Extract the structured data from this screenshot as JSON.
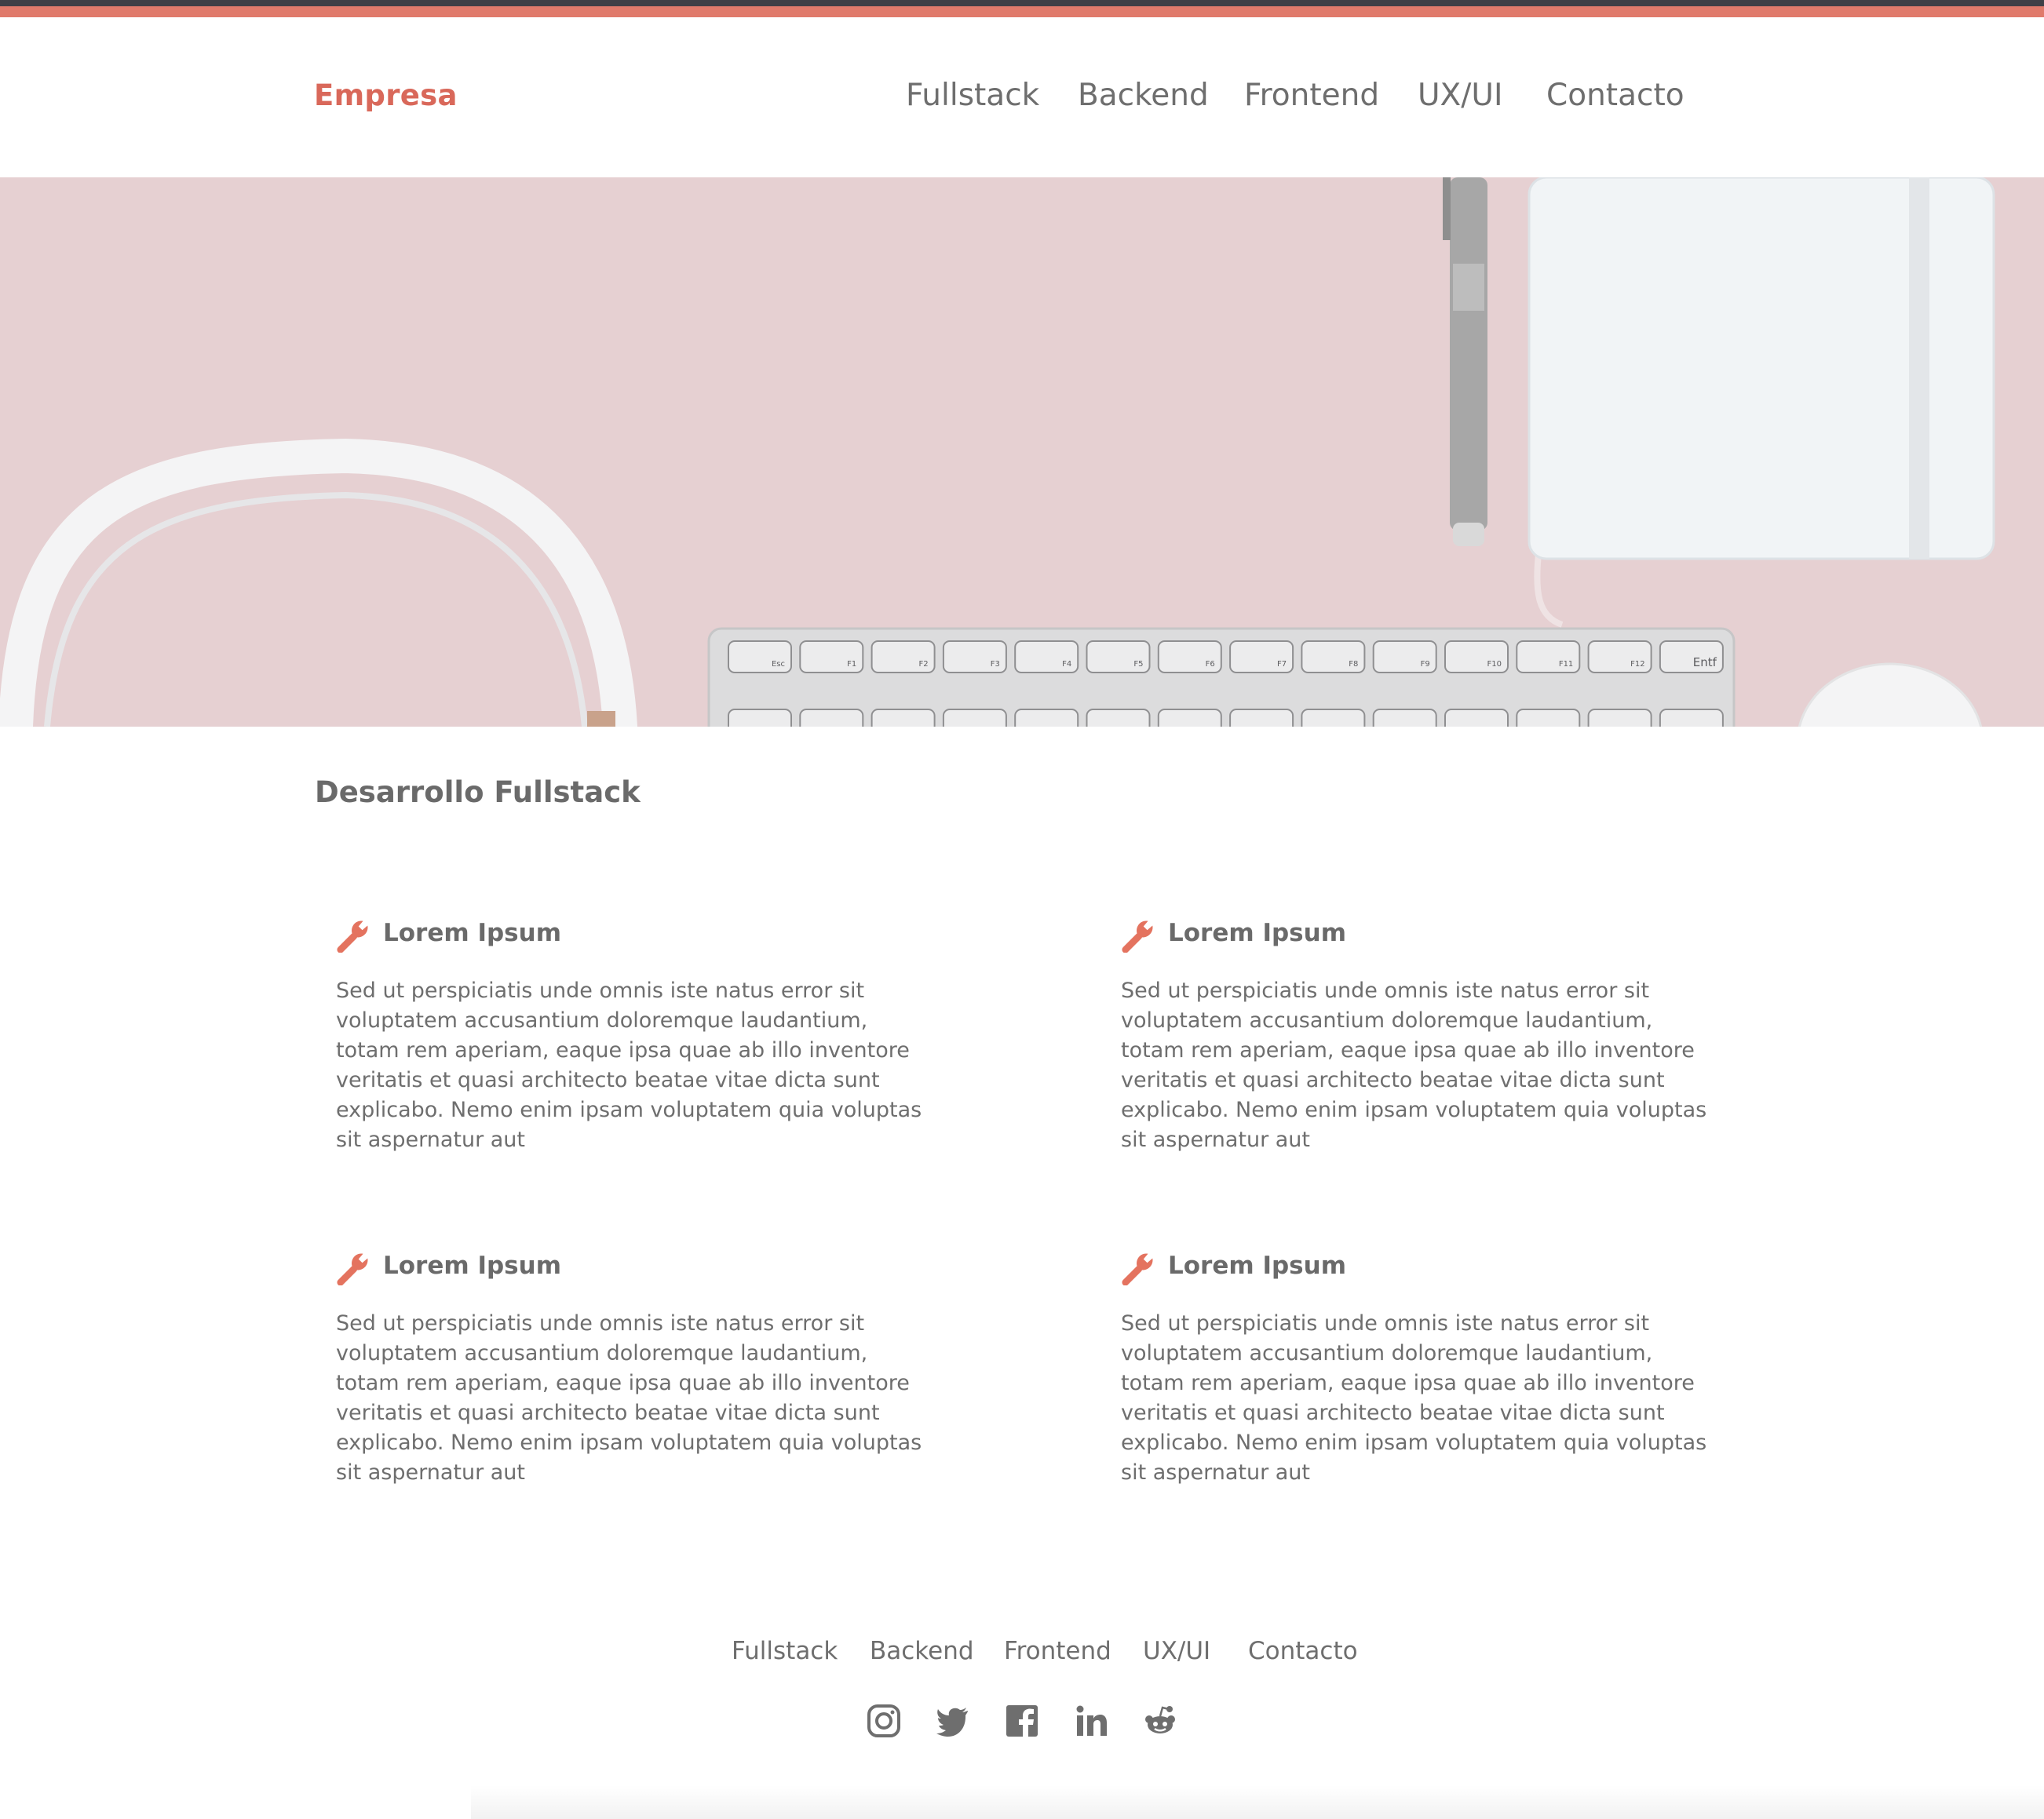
{
  "colors": {
    "accent": "#d9685a",
    "top_bar": "#e07a6b",
    "top_bar_dark": "#3f3f46",
    "text": "#6e6e6e",
    "hero_bg": "#e6d0d2"
  },
  "header": {
    "brand": "Empresa",
    "nav": [
      "Fullstack",
      "Backend",
      "Frontend",
      "UX/UI",
      "Contacto"
    ]
  },
  "hero": {
    "keyboard_keys": [
      "Esc",
      "F1",
      "F2",
      "F3",
      "F4",
      "F5",
      "F6",
      "F7",
      "F8",
      "F9",
      "F10",
      "F11",
      "F12",
      "Entf"
    ]
  },
  "main": {
    "title": "Desarrollo Fullstack",
    "cards": [
      {
        "icon": "wrench-icon",
        "title": "Lorem Ipsum",
        "text": "Sed ut perspiciatis unde omnis iste natus error sit voluptatem accusantium doloremque laudantium, totam rem aperiam, eaque ipsa quae ab illo inventore veritatis et quasi architecto beatae vitae dicta sunt explicabo. Nemo enim ipsam voluptatem quia voluptas sit aspernatur aut"
      },
      {
        "icon": "wrench-icon",
        "title": "Lorem Ipsum",
        "text": "Sed ut perspiciatis unde omnis iste natus error sit voluptatem accusantium doloremque laudantium, totam rem aperiam, eaque ipsa quae ab illo inventore veritatis et quasi architecto beatae vitae dicta sunt explicabo. Nemo enim ipsam voluptatem quia voluptas sit aspernatur aut"
      },
      {
        "icon": "wrench-icon",
        "title": "Lorem Ipsum",
        "text": "Sed ut perspiciatis unde omnis iste natus error sit voluptatem accusantium doloremque laudantium, totam rem aperiam, eaque ipsa quae ab illo inventore veritatis et quasi architecto beatae vitae dicta sunt explicabo. Nemo enim ipsam voluptatem quia voluptas sit aspernatur aut"
      },
      {
        "icon": "wrench-icon",
        "title": "Lorem Ipsum",
        "text": "Sed ut perspiciatis unde omnis iste natus error sit voluptatem accusantium doloremque laudantium, totam rem aperiam, eaque ipsa quae ab illo inventore veritatis et quasi architecto beatae vitae dicta sunt explicabo. Nemo enim ipsam voluptatem quia voluptas sit aspernatur aut"
      }
    ]
  },
  "footer": {
    "nav": [
      "Fullstack",
      "Backend",
      "Frontend",
      "UX/UI",
      "Contacto"
    ],
    "social": [
      "instagram-icon",
      "twitter-icon",
      "facebook-icon",
      "linkedin-icon",
      "reddit-icon"
    ]
  }
}
